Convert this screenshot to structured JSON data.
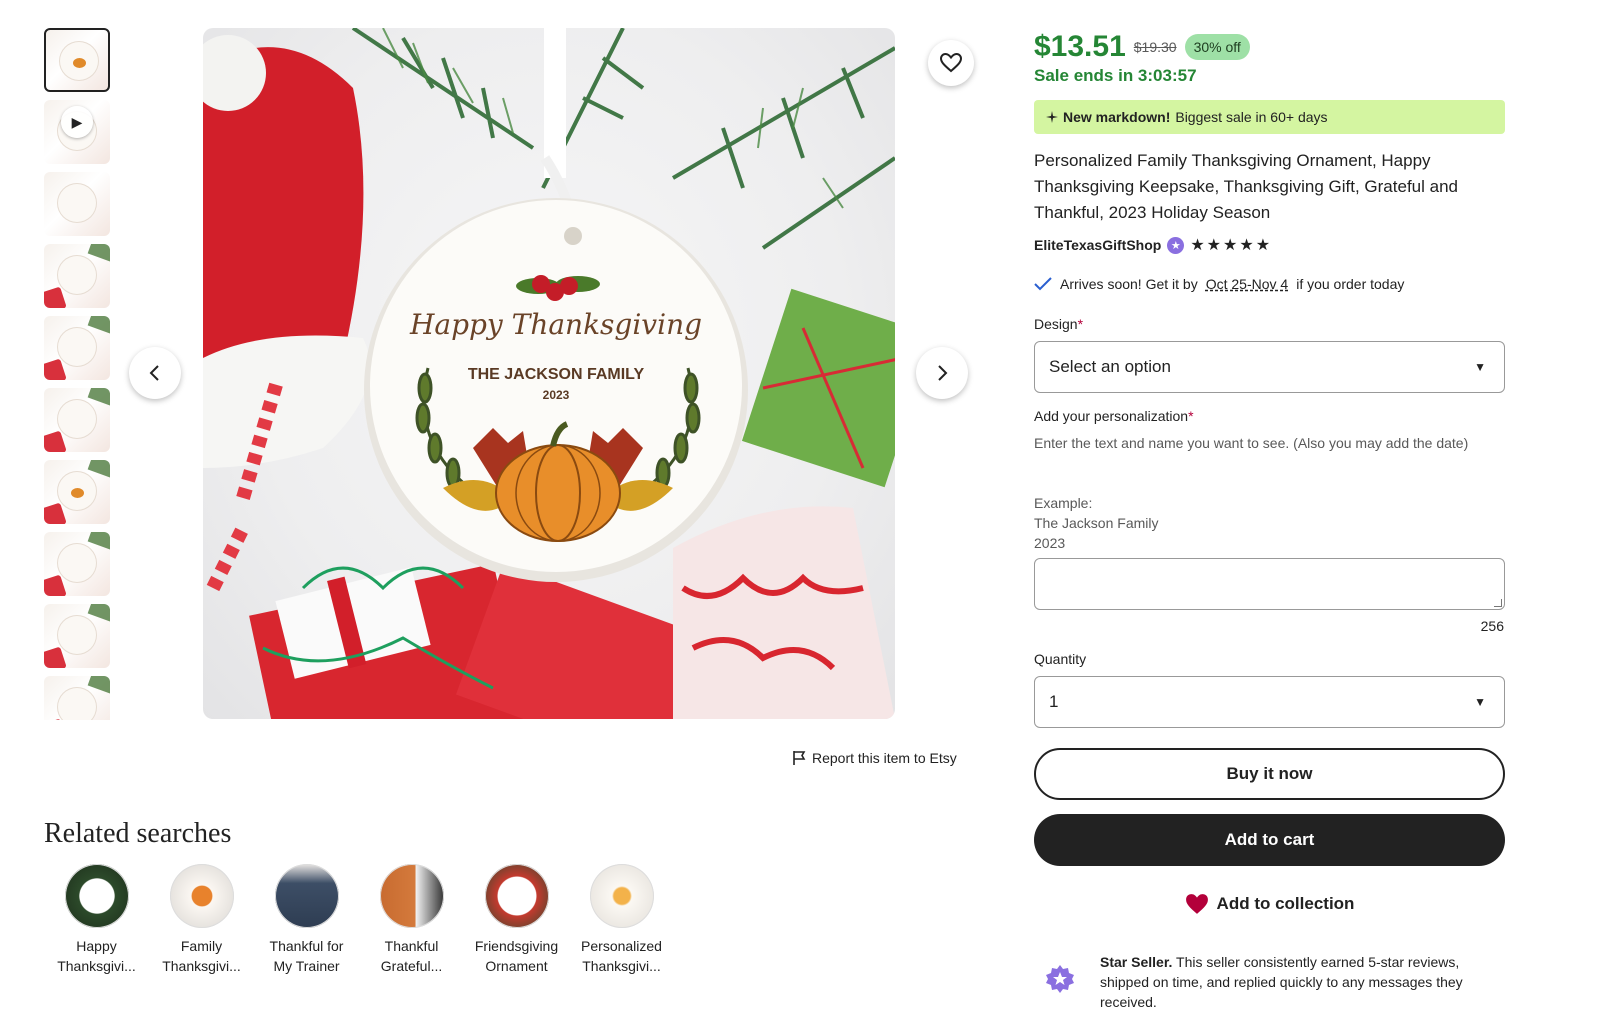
{
  "product": {
    "price": "$13.51",
    "original_price": "$19.30",
    "discount_badge": "30% off",
    "sale_ends": "Sale ends in 3:03:57",
    "markdown_strong": "New markdown!",
    "markdown_text": "Biggest sale in 60+ days",
    "title": "Personalized Family Thanksgiving Ornament, Happy Thanksgiving Keepsake, Thanksgiving Gift, Grateful and Thankful, 2023 Holiday Season",
    "shop_name": "EliteTexasGiftShop",
    "rating_stars": "★★★★★",
    "arrives_prefix": "Arrives soon! Get it by",
    "arrives_dates": "Oct 25-Nov 4",
    "arrives_suffix": "if you order today"
  },
  "ornament": {
    "heading": "Happy Thanksgiving",
    "family": "THE JACKSON FAMILY",
    "year": "2023"
  },
  "form": {
    "design_label": "Design",
    "required_mark": "*",
    "design_value": "Select an option",
    "personalization_label": "Add your personalization",
    "personalization_help": "Enter the text and name you want to see. (Also you may add the date)",
    "example_line1": "Example:",
    "example_line2": "The Jackson Family",
    "example_line3": "2023",
    "char_counter": "256",
    "quantity_label": "Quantity",
    "quantity_value": "1"
  },
  "actions": {
    "buy_now": "Buy it now",
    "add_to_cart": "Add to cart",
    "add_to_collection": "Add to collection",
    "report": "Report this item to Etsy"
  },
  "star_seller": {
    "strong": "Star Seller.",
    "text": "This seller consistently earned 5-star reviews, shipped on time, and replied quickly to any messages they received."
  },
  "related": {
    "title": "Related searches",
    "items": [
      {
        "label": "Happy\nThanksgivi..."
      },
      {
        "label": "Family\nThanksgivi..."
      },
      {
        "label": "Thankful for\nMy Trainer"
      },
      {
        "label": "Thankful\nGrateful..."
      },
      {
        "label": "Friendsgiving\nOrnament"
      },
      {
        "label": "Personalized\nThanksgivi..."
      }
    ]
  },
  "colors": {
    "sale_green": "#258635",
    "markdown_bg": "#d4f5a1",
    "badge_bg": "#9ee0a6",
    "primary_dark": "#222222",
    "heart_red": "#b3003a",
    "star_seller_purple": "#8a6fe0"
  },
  "icons": {
    "favorite": "heart-outline-icon",
    "prev": "chevron-left-icon",
    "next": "chevron-right-icon",
    "play": "play-icon",
    "report": "flag-icon",
    "collection": "heart-filled-icon",
    "delivery": "checkmark-icon",
    "markdown": "sparkle-icon",
    "dropdown": "caret-down-icon"
  }
}
